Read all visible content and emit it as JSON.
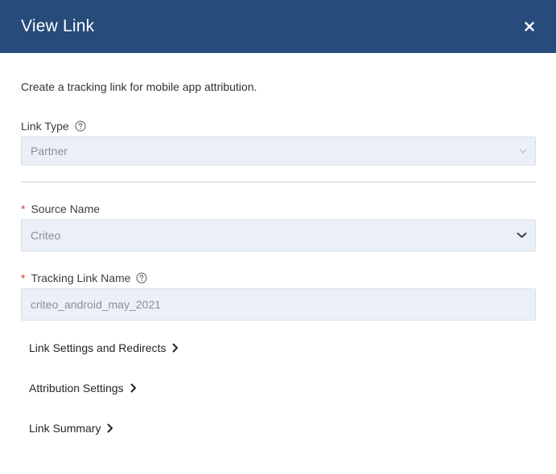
{
  "header": {
    "title": "View Link"
  },
  "description": "Create a tracking link for mobile app attribution.",
  "link_type": {
    "label": "Link Type",
    "value": "Partner"
  },
  "source_name": {
    "label": "Source Name",
    "required_mark": "*",
    "value": "Criteo"
  },
  "tracking_link_name": {
    "label": "Tracking Link Name",
    "required_mark": "*",
    "value": "criteo_android_may_2021"
  },
  "sections": [
    {
      "label": "Link Settings and Redirects"
    },
    {
      "label": "Attribution Settings"
    },
    {
      "label": "Link Summary"
    }
  ],
  "colors": {
    "header_bg": "#274b7a",
    "required": "#d93a35",
    "field_bg": "#eaf0f5"
  }
}
